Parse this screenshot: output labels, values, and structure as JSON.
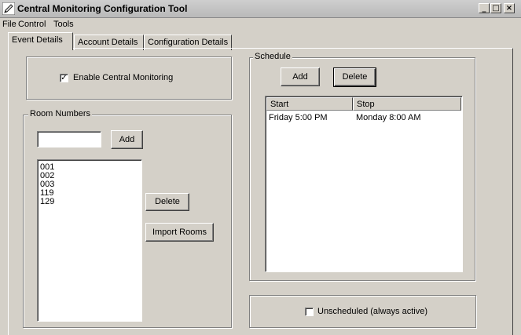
{
  "window": {
    "title": "Central Monitoring Configuration Tool"
  },
  "window_controls": {
    "minimize": "_",
    "maximize": "□",
    "close": "×"
  },
  "menu": {
    "items": [
      "File",
      "Control",
      "Tools"
    ]
  },
  "tabs": [
    {
      "label": "Event Details",
      "active": true
    },
    {
      "label": "Account Details",
      "active": false
    },
    {
      "label": "Configuration Details",
      "active": false
    }
  ],
  "enable_monitoring": {
    "label": "Enable Central Monitoring",
    "checked": true,
    "mark": "✓"
  },
  "rooms": {
    "group_label": "Room Numbers",
    "input_value": "",
    "add_label": "Add",
    "items": [
      "001",
      "002",
      "003",
      "119",
      "129"
    ],
    "delete_label": "Delete",
    "import_label": "Import Rooms"
  },
  "schedule": {
    "group_label": "Schedule",
    "add_label": "Add",
    "delete_label": "Delete",
    "columns": [
      "Start",
      "Stop"
    ],
    "rows": [
      {
        "start": "Friday 5:00 PM",
        "stop": "Monday 8:00 AM"
      }
    ]
  },
  "unscheduled": {
    "label": "Unscheduled (always active)",
    "checked": false
  }
}
